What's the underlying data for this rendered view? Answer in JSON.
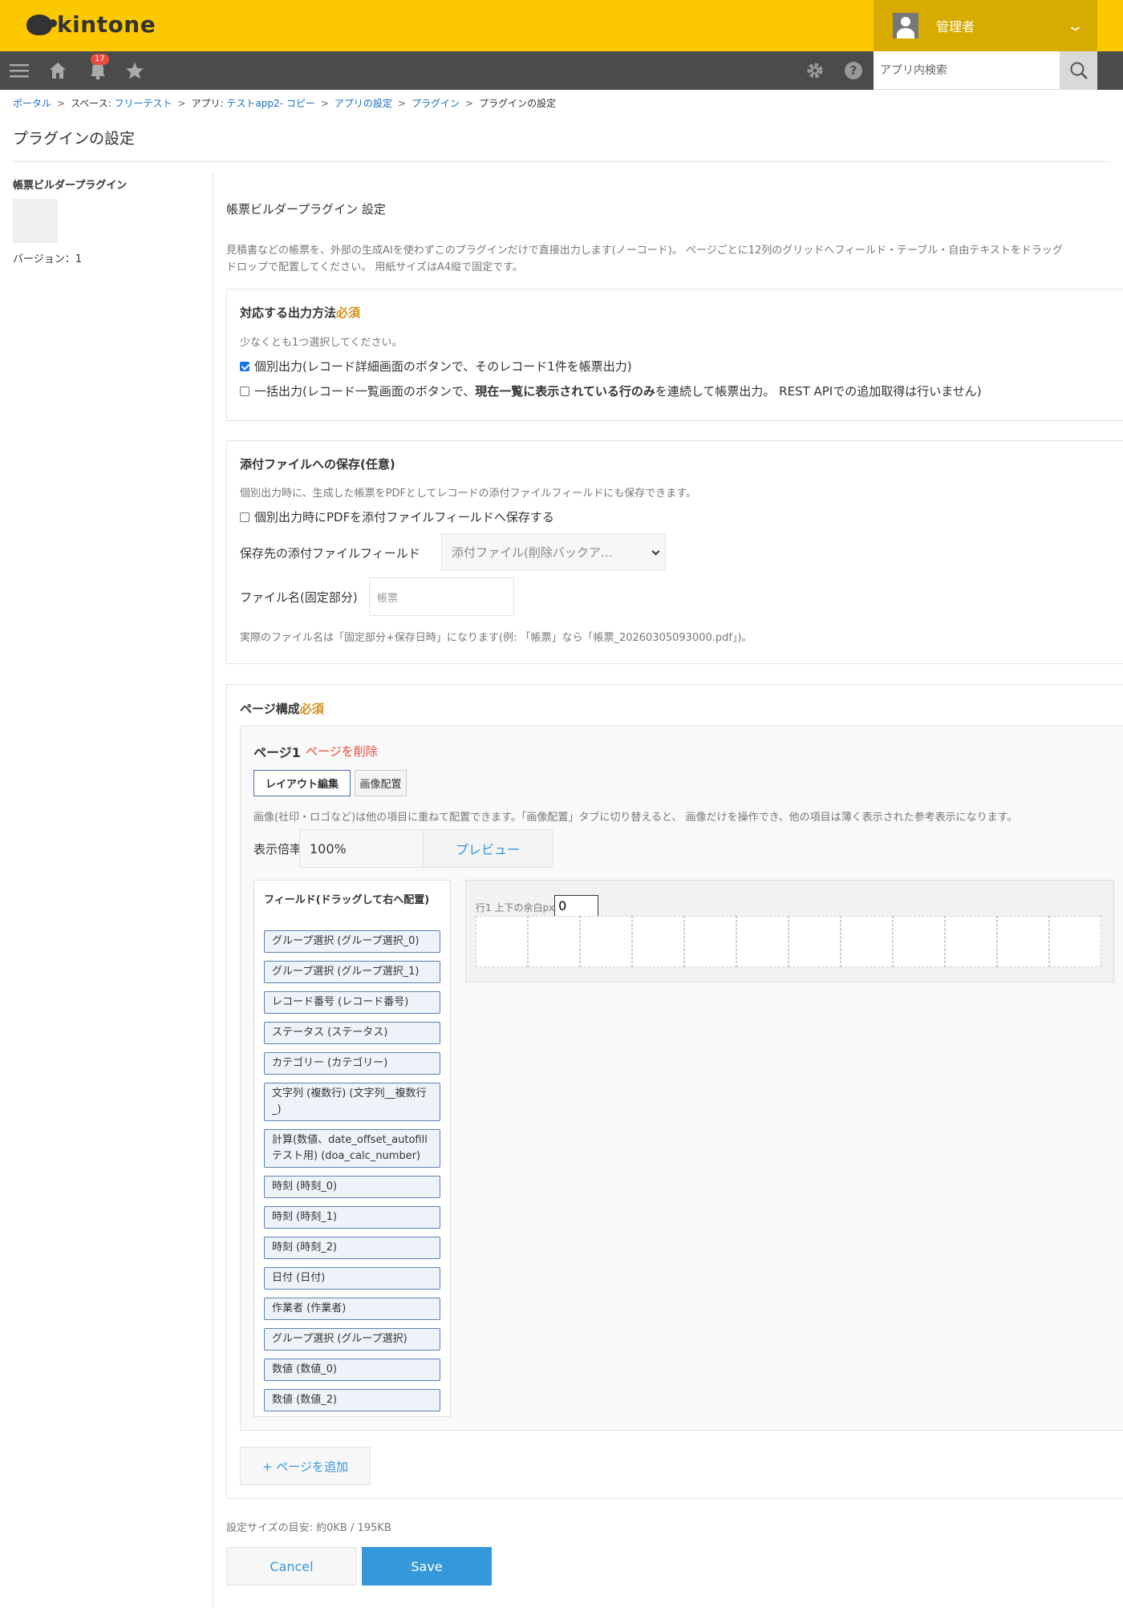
{
  "header": {
    "logo_text": "kintone",
    "user_name": "管理者",
    "notification_count": "17",
    "search_placeholder": "アプリ内検索"
  },
  "breadcrumb": {
    "portal": "ポータル",
    "space_prefix": "スペース:",
    "space": "フリーテスト",
    "app_prefix": "アプリ:",
    "app": "テストapp2- コピー",
    "app_settings": "アプリの設定",
    "plugins": "プラグイン",
    "current": "プラグインの設定",
    "separator": ">"
  },
  "page_title": "プラグインの設定",
  "sidebar": {
    "plugin_name": "帳票ビルダープラグイン",
    "version": "バージョン：1"
  },
  "main": {
    "heading": "帳票ビルダープラグイン 設定",
    "description_line1": "見積書などの帳票を、外部の生成AIを使わずこのプラグインだけで直接出力します(ノーコード)。 ページごとに12列のグリッドへフィールド・テーブル・自由テキストをドラッグ",
    "description_line2": "ドロップで配置してください。 用紙サイズはA4縦で固定です。",
    "output_method": {
      "title": "対応する出力方法",
      "required": "必須",
      "hint": "少なくとも1つ選択してください。",
      "opt1": "個別出力(レコード詳細画面のボタンで、そのレコード1件を帳票出力)",
      "opt2_pre": "一括出力(レコード一覧画面のボタンで、",
      "opt2_bold": "現在一覧に表示されている行のみ",
      "opt2_post": "を連続して帳票出力。 REST APIでの追加取得は行いません)"
    },
    "attachment": {
      "title": "添付ファイルへの保存(任意)",
      "hint": "個別出力時に、生成した帳票をPDFとしてレコードの添付ファイルフィールドにも保存できます。",
      "checkbox": "個別出力時にPDFを添付ファイルフィールドへ保存する",
      "field_label": "保存先の添付ファイルフィールド",
      "field_value": "添付ファイル(削除バックア…",
      "filename_label": "ファイル名(固定部分)",
      "filename_placeholder": "帳票",
      "note": "実際のファイル名は「固定部分+保存日時」になります(例: 「帳票」なら「帳票_20260305093000.pdf」)。"
    },
    "page_config": {
      "title": "ページ構成",
      "required": "必須",
      "page_label": "ページ1",
      "delete_page": "ページを削除",
      "tabs": [
        "レイアウト編集",
        "画像配置"
      ],
      "image_hint": "画像(社印・ロゴなど)は他の項目に重ねて配置できます。「画像配置」タブに切り替えると、 画像だけを操作でき、他の項目は薄く表示された参考表示になります。",
      "zoom_label": "表示倍率:",
      "zoom_value": "100%",
      "preview_button": "プレビュー",
      "fields_header": "フィールド(ドラッグして右へ配置)",
      "fields": [
        "グループ選択 (グループ選択_0)",
        "グループ選択 (グループ選択_1)",
        "レコード番号 (レコード番号)",
        "ステータス (ステータス)",
        "カテゴリー (カテゴリー)",
        "文字列 (複数行) (文字列__複数行_)",
        "計算(数値、date_offset_autofillテスト用) (doa_calc_number)",
        "時刻 (時刻_0)",
        "時刻 (時刻_1)",
        "時刻 (時刻_2)",
        "日付 (日付)",
        "作業者 (作業者)",
        "グループ選択 (グループ選択)",
        "数値 (数値_0)",
        "数値 (数値_2)"
      ],
      "row_label": "行1 上下の余白px",
      "row_padding_value": "0",
      "grid_columns": 12,
      "add_page": "+ ページを追加"
    },
    "size_note": "設定サイズの目安: 約0KB / 195KB",
    "cancel": "Cancel",
    "save": "Save"
  },
  "colors": {
    "header": "#fcc800",
    "navbar": "#4b4b4b",
    "link": "#1a6ec1",
    "required": "#d28f1a",
    "save": "#3498db"
  }
}
